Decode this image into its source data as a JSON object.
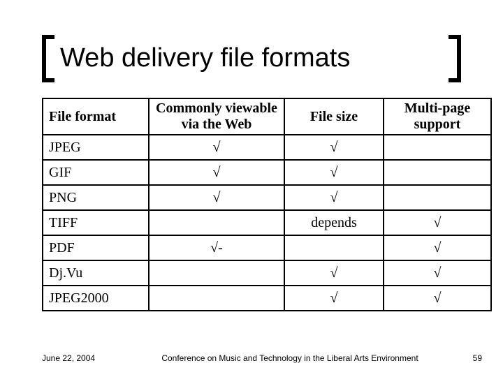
{
  "title": "Web delivery file formats",
  "columns": {
    "format": "File format",
    "web": "Commonly viewable via the Web",
    "size": "File size",
    "multi": "Multi-page support"
  },
  "rows": [
    {
      "format": "JPEG",
      "web": "√",
      "size": "√",
      "multi": ""
    },
    {
      "format": "GIF",
      "web": "√",
      "size": "√",
      "multi": ""
    },
    {
      "format": "PNG",
      "web": "√",
      "size": "√",
      "multi": ""
    },
    {
      "format": "TIFF",
      "web": "",
      "size": "depends",
      "multi": "√"
    },
    {
      "format": "PDF",
      "web": "√-",
      "size": "",
      "multi": "√"
    },
    {
      "format": "Dj.Vu",
      "web": "",
      "size": "√",
      "multi": "√"
    },
    {
      "format": "JPEG2000",
      "web": "",
      "size": "√",
      "multi": "√"
    }
  ],
  "footer": {
    "date": "June 22, 2004",
    "conference": "Conference on Music and Technology in the Liberal Arts Environment",
    "page": "59"
  }
}
